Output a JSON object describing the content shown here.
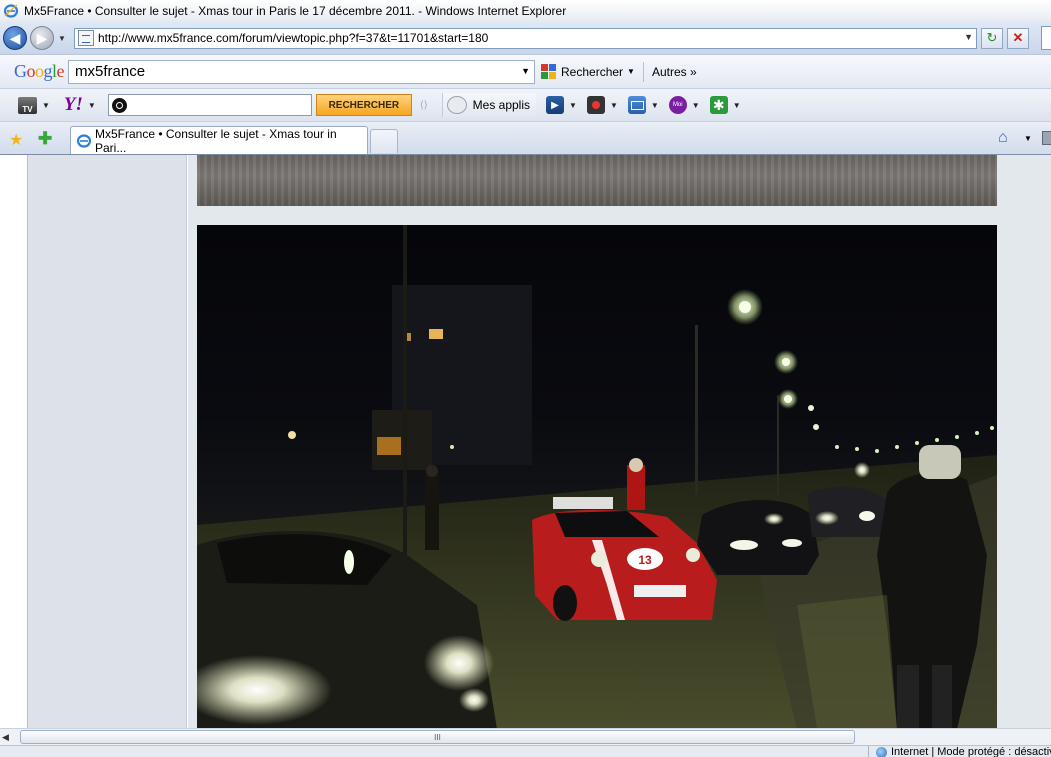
{
  "window": {
    "title": "Mx5France • Consulter le sujet - Xmas tour in Paris le 17 décembre 2011. - Windows Internet Explorer"
  },
  "address_bar": {
    "url": "http://www.mx5france.com/forum/viewtopic.php?f=37&t=11701&start=180"
  },
  "google_toolbar": {
    "logo": "Google",
    "search_value": "mx5france",
    "search_button": "Rechercher",
    "more_button": "Autres »"
  },
  "yahoo_toolbar": {
    "tv_label": "TV",
    "logo": "Y!",
    "search_value": "",
    "search_button": "RECHERCHER",
    "apps_label": "Mes applis",
    "moi_label": "Moi"
  },
  "tabs": [
    {
      "label": "Mx5France • Consulter le sujet - Xmas tour in Pari...",
      "active": true
    }
  ],
  "scrollbar": {
    "thumb_grip": "III"
  },
  "status_bar": {
    "zone": "Internet | Mode protégé : désactivé"
  },
  "colors": {
    "titlebar_bg": "#e6eaf0",
    "forum_sidebar": "#dce2e8",
    "forum_post_bg": "#e3e8ed",
    "yahoo_purple": "#7b0099",
    "yahoo_button": "#f5a623"
  },
  "icons": {
    "back": "back-arrow-icon",
    "forward": "forward-arrow-icon",
    "refresh": "refresh-icon",
    "stop": "stop-icon",
    "favorites": "favorites-star-icon",
    "add_favorite": "add-favorite-icon",
    "home": "home-icon"
  }
}
